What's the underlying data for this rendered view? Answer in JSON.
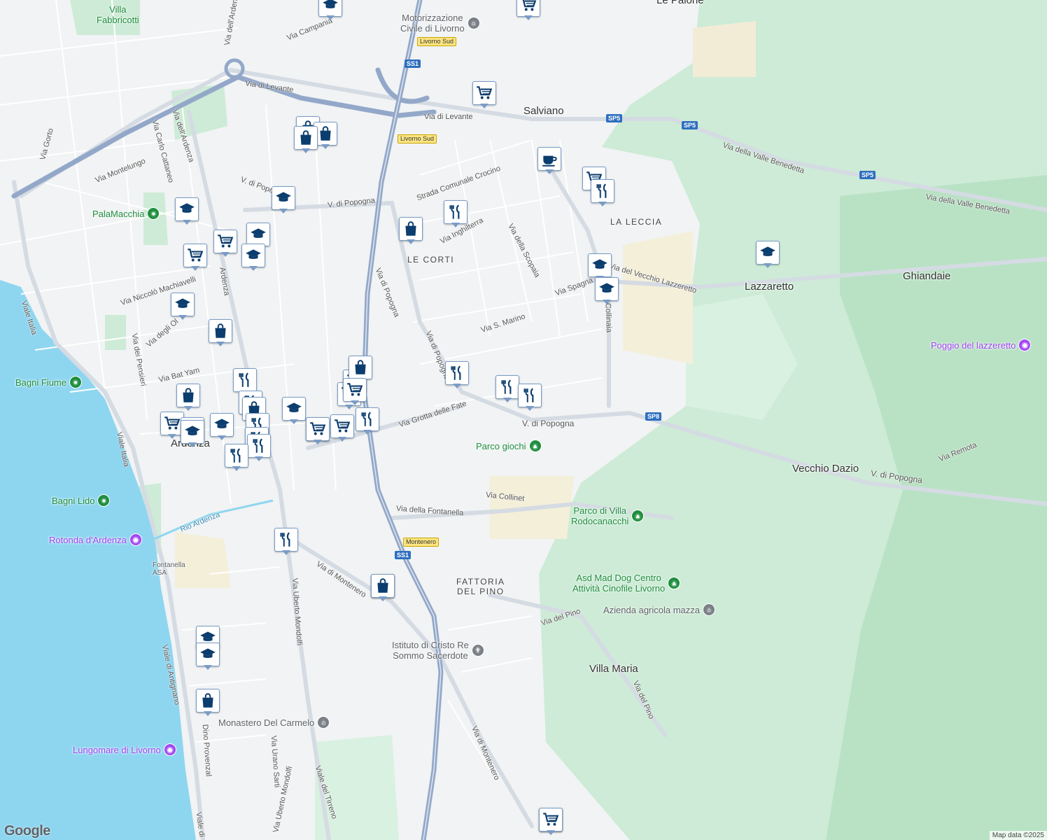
{
  "roads": [
    {
      "t": "Via Campania"
    },
    {
      "t": "Via di Levante"
    },
    {
      "t": "Via di Levante"
    },
    {
      "t": "Via Gorto"
    },
    {
      "t": "Via Carlo Cattaneo"
    },
    {
      "t": "Via dell'Ardenza"
    },
    {
      "t": "Via Montelungo"
    },
    {
      "t": "V. di Popogna"
    },
    {
      "t": "V. di Popogna"
    },
    {
      "t": "Strada Comunale Crocino"
    },
    {
      "t": "Via Inghilterra"
    },
    {
      "t": "Via della Scopaia"
    },
    {
      "t": "Via della Valle Benedetta"
    },
    {
      "t": "Via della Valle Benedetta"
    },
    {
      "t": "Via Niccolò Machiavelli"
    },
    {
      "t": "Ardenza"
    },
    {
      "t": "Via di Popogna"
    },
    {
      "t": "Via Spagna"
    },
    {
      "t": "Via del Vecchio Lazzeretto"
    },
    {
      "t": "Via S. Marino"
    },
    {
      "t": "Collinaia"
    },
    {
      "t": "Via degli Ol"
    },
    {
      "t": "Via dei Pensieri"
    },
    {
      "t": "Via Bat Yam"
    },
    {
      "t": "Via di Popogna"
    },
    {
      "t": "Via Grotta delle Fate"
    },
    {
      "t": "V. di Popogna"
    },
    {
      "t": "V. di Popogna"
    },
    {
      "t": "Via Remota"
    },
    {
      "t": "Via Collinet"
    },
    {
      "t": "Via della Fontanella"
    },
    {
      "t": "Viale Italia"
    },
    {
      "t": "Viale Italia"
    },
    {
      "t": "Rio Ardenza"
    },
    {
      "t": "Via di Montenero"
    },
    {
      "t": "Via Uberto Mondolfi"
    },
    {
      "t": "Viale di Antignano"
    },
    {
      "t": "Via del Pino"
    },
    {
      "t": "Via del Pino"
    },
    {
      "t": "Dino Provenzal"
    },
    {
      "t": "Via Urano Sarti"
    },
    {
      "t": "Via Uberto Mondolfi"
    },
    {
      "t": "Viale del Tirreno"
    },
    {
      "t": "Via di Montenero"
    },
    {
      "t": "Viale di"
    },
    {
      "t": "Via dell'Ardenza"
    }
  ],
  "places": [
    {
      "t": "Salviano"
    },
    {
      "t": "Lazzaretto"
    },
    {
      "t": "Ghiandaie"
    },
    {
      "t": "Vecchio Dazio"
    },
    {
      "t": "Villa Maria"
    },
    {
      "t": "Ardenza"
    },
    {
      "t": "Le Palone"
    }
  ],
  "districts": [
    {
      "t": "LA LECCIA"
    },
    {
      "t": "LE CORTI"
    },
    {
      "t": "FATTORIA\nDEL PINO"
    }
  ],
  "pois": [
    {
      "t": "Villa\nFabbricotti",
      "c": "green"
    },
    {
      "t": "Motorizzazione\nCivile di Livorno",
      "c": "gray",
      "icon": "bank-icon"
    },
    {
      "t": "PalaMacchia",
      "c": "green",
      "icon": "sports-icon"
    },
    {
      "t": "Bagni Fiume",
      "c": "green",
      "icon": "beach-icon"
    },
    {
      "t": "Bagni Lido",
      "c": "green",
      "icon": "beach-icon"
    },
    {
      "t": "Rotonda d'Ardenza",
      "c": "purple",
      "icon": "camera-icon"
    },
    {
      "t": "Parco giochi",
      "c": "green",
      "icon": "tree-icon"
    },
    {
      "t": "Parco di Villa\nRodocanacchi",
      "c": "green",
      "icon": "tree-icon"
    },
    {
      "t": "Asd Mad Dog Centro\nAttività Cinofile Livorno",
      "c": "green",
      "icon": "tree-icon"
    },
    {
      "t": "Azienda agricola mazza",
      "c": "gray",
      "icon": "bank-icon"
    },
    {
      "t": "Istituto di Cristo Re\nSommo Sacerdote",
      "c": "gray",
      "icon": "church-icon"
    },
    {
      "t": "Monastero Del Carmelo",
      "c": "gray",
      "icon": "monastery-icon"
    },
    {
      "t": "Lungomare di Livorno",
      "c": "purple",
      "icon": "camera-icon"
    },
    {
      "t": "Poggio del lazzeretto",
      "c": "purple",
      "icon": "camera-icon"
    },
    {
      "t": "Fontanella\nASA",
      "c": "gray"
    }
  ],
  "shields": [
    "SS1",
    "SP5",
    "SP5",
    "SP5",
    "SP8",
    "SS1"
  ],
  "exits": [
    "Livorno Sud",
    "Livorno Sud",
    "Montenero"
  ],
  "markers": [
    {
      "type": "cart"
    },
    {
      "type": "school"
    },
    {
      "type": "school"
    },
    {
      "type": "cart"
    },
    {
      "type": "school"
    },
    {
      "type": "bag"
    },
    {
      "type": "bag"
    },
    {
      "type": "bag"
    },
    {
      "type": "school"
    },
    {
      "type": "cart"
    },
    {
      "type": "school"
    },
    {
      "type": "cart"
    },
    {
      "type": "school"
    },
    {
      "type": "school"
    },
    {
      "type": "bag"
    },
    {
      "type": "fork"
    },
    {
      "type": "bag"
    },
    {
      "type": "fork"
    },
    {
      "type": "bag"
    },
    {
      "type": "cart"
    },
    {
      "type": "cart"
    },
    {
      "type": "school"
    },
    {
      "type": "school"
    },
    {
      "type": "fork"
    },
    {
      "type": "fork"
    },
    {
      "type": "fork"
    },
    {
      "type": "fork"
    },
    {
      "type": "school"
    },
    {
      "type": "cart"
    },
    {
      "type": "cart"
    },
    {
      "type": "bag"
    },
    {
      "type": "cart"
    },
    {
      "type": "cart"
    },
    {
      "type": "fork"
    },
    {
      "type": "bag"
    },
    {
      "type": "fork"
    },
    {
      "type": "bag"
    },
    {
      "type": "fork"
    },
    {
      "type": "fork"
    },
    {
      "type": "fork"
    },
    {
      "type": "cart"
    },
    {
      "type": "coffee"
    },
    {
      "type": "cart"
    },
    {
      "type": "fork"
    },
    {
      "type": "school"
    },
    {
      "type": "school"
    },
    {
      "type": "school"
    },
    {
      "type": "fork"
    },
    {
      "type": "school"
    },
    {
      "type": "bag"
    },
    {
      "type": "school"
    },
    {
      "type": "cart"
    },
    {
      "type": "bag"
    },
    {
      "type": "cart"
    }
  ],
  "branding": {
    "logo": "Google",
    "attribution": "Map data ©2025"
  },
  "colors": {
    "sea": "#8ed6f0",
    "green": "#cdebd6",
    "dark_green": "#b6dfc3",
    "highway": "#93a8c9",
    "marker_icon": "#0b3d6e"
  }
}
